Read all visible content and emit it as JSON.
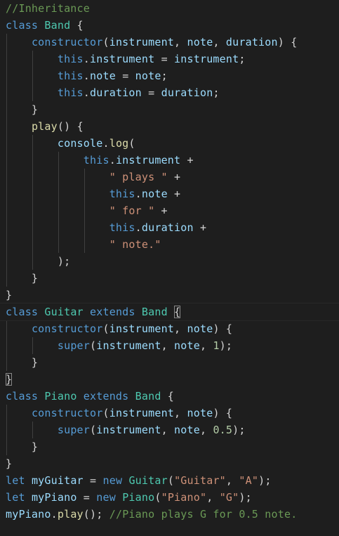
{
  "colors": {
    "background": "#1e1e1e",
    "comment": "#6a9955",
    "keyword": "#569cd6",
    "class_name": "#4ec9b0",
    "function": "#dcdcaa",
    "variable": "#9cdcfe",
    "string": "#ce9178",
    "number": "#b5cea8",
    "plain": "#d4d4d4"
  },
  "lines": [
    {
      "tokens": [
        {
          "t": "//Inheritance",
          "k": "comment"
        }
      ]
    },
    {
      "tokens": [
        {
          "t": "class ",
          "k": "keyword"
        },
        {
          "t": "Band",
          "k": "class_name"
        },
        {
          "t": " {",
          "k": "plain"
        }
      ]
    },
    {
      "tokens": [
        {
          "t": "    ",
          "k": "plain"
        },
        {
          "t": "constructor",
          "k": "keyword"
        },
        {
          "t": "(",
          "k": "plain"
        },
        {
          "t": "instrument",
          "k": "variable"
        },
        {
          "t": ", ",
          "k": "plain"
        },
        {
          "t": "note",
          "k": "variable"
        },
        {
          "t": ", ",
          "k": "plain"
        },
        {
          "t": "duration",
          "k": "variable"
        },
        {
          "t": ") {",
          "k": "plain"
        }
      ]
    },
    {
      "tokens": [
        {
          "t": "        ",
          "k": "plain"
        },
        {
          "t": "this",
          "k": "keyword"
        },
        {
          "t": ".",
          "k": "plain"
        },
        {
          "t": "instrument",
          "k": "variable"
        },
        {
          "t": " = ",
          "k": "plain"
        },
        {
          "t": "instrument",
          "k": "variable"
        },
        {
          "t": ";",
          "k": "plain"
        }
      ]
    },
    {
      "tokens": [
        {
          "t": "        ",
          "k": "plain"
        },
        {
          "t": "this",
          "k": "keyword"
        },
        {
          "t": ".",
          "k": "plain"
        },
        {
          "t": "note",
          "k": "variable"
        },
        {
          "t": " = ",
          "k": "plain"
        },
        {
          "t": "note",
          "k": "variable"
        },
        {
          "t": ";",
          "k": "plain"
        }
      ]
    },
    {
      "tokens": [
        {
          "t": "        ",
          "k": "plain"
        },
        {
          "t": "this",
          "k": "keyword"
        },
        {
          "t": ".",
          "k": "plain"
        },
        {
          "t": "duration",
          "k": "variable"
        },
        {
          "t": " = ",
          "k": "plain"
        },
        {
          "t": "duration",
          "k": "variable"
        },
        {
          "t": ";",
          "k": "plain"
        }
      ]
    },
    {
      "tokens": [
        {
          "t": "    }",
          "k": "plain"
        }
      ]
    },
    {
      "tokens": [
        {
          "t": "    ",
          "k": "plain"
        },
        {
          "t": "play",
          "k": "function"
        },
        {
          "t": "() {",
          "k": "plain"
        }
      ]
    },
    {
      "tokens": [
        {
          "t": "        ",
          "k": "plain"
        },
        {
          "t": "console",
          "k": "variable"
        },
        {
          "t": ".",
          "k": "plain"
        },
        {
          "t": "log",
          "k": "function"
        },
        {
          "t": "(",
          "k": "plain"
        }
      ]
    },
    {
      "tokens": [
        {
          "t": "            ",
          "k": "plain"
        },
        {
          "t": "this",
          "k": "keyword"
        },
        {
          "t": ".",
          "k": "plain"
        },
        {
          "t": "instrument",
          "k": "variable"
        },
        {
          "t": " +",
          "k": "plain"
        }
      ]
    },
    {
      "tokens": [
        {
          "t": "                ",
          "k": "plain"
        },
        {
          "t": "\" plays \"",
          "k": "string"
        },
        {
          "t": " +",
          "k": "plain"
        }
      ]
    },
    {
      "tokens": [
        {
          "t": "                ",
          "k": "plain"
        },
        {
          "t": "this",
          "k": "keyword"
        },
        {
          "t": ".",
          "k": "plain"
        },
        {
          "t": "note",
          "k": "variable"
        },
        {
          "t": " +",
          "k": "plain"
        }
      ]
    },
    {
      "tokens": [
        {
          "t": "                ",
          "k": "plain"
        },
        {
          "t": "\" for \"",
          "k": "string"
        },
        {
          "t": " +",
          "k": "plain"
        }
      ]
    },
    {
      "tokens": [
        {
          "t": "                ",
          "k": "plain"
        },
        {
          "t": "this",
          "k": "keyword"
        },
        {
          "t": ".",
          "k": "plain"
        },
        {
          "t": "duration",
          "k": "variable"
        },
        {
          "t": " +",
          "k": "plain"
        }
      ]
    },
    {
      "tokens": [
        {
          "t": "                ",
          "k": "plain"
        },
        {
          "t": "\" note.\"",
          "k": "string"
        }
      ]
    },
    {
      "tokens": [
        {
          "t": "        );",
          "k": "plain"
        }
      ]
    },
    {
      "tokens": [
        {
          "t": "    }",
          "k": "plain"
        }
      ]
    },
    {
      "tokens": [
        {
          "t": "}",
          "k": "plain"
        }
      ]
    },
    {
      "active": true,
      "tokens": [
        {
          "t": "class ",
          "k": "keyword"
        },
        {
          "t": "Guitar",
          "k": "class_name"
        },
        {
          "t": " ",
          "k": "plain"
        },
        {
          "t": "extends",
          "k": "keyword"
        },
        {
          "t": " ",
          "k": "plain"
        },
        {
          "t": "Band",
          "k": "class_name"
        },
        {
          "t": " ",
          "k": "plain"
        },
        {
          "t": "{",
          "k": "plain",
          "boxed": true
        }
      ]
    },
    {
      "tokens": [
        {
          "t": "    ",
          "k": "plain"
        },
        {
          "t": "constructor",
          "k": "keyword"
        },
        {
          "t": "(",
          "k": "plain"
        },
        {
          "t": "instrument",
          "k": "variable"
        },
        {
          "t": ", ",
          "k": "plain"
        },
        {
          "t": "note",
          "k": "variable"
        },
        {
          "t": ") {",
          "k": "plain"
        }
      ]
    },
    {
      "tokens": [
        {
          "t": "        ",
          "k": "plain"
        },
        {
          "t": "super",
          "k": "keyword"
        },
        {
          "t": "(",
          "k": "plain"
        },
        {
          "t": "instrument",
          "k": "variable"
        },
        {
          "t": ", ",
          "k": "plain"
        },
        {
          "t": "note",
          "k": "variable"
        },
        {
          "t": ", ",
          "k": "plain"
        },
        {
          "t": "1",
          "k": "number"
        },
        {
          "t": ");",
          "k": "plain"
        }
      ]
    },
    {
      "tokens": [
        {
          "t": "    }",
          "k": "plain"
        }
      ]
    },
    {
      "tokens": [
        {
          "t": "}",
          "k": "plain",
          "boxed": true
        }
      ]
    },
    {
      "tokens": [
        {
          "t": "class ",
          "k": "keyword"
        },
        {
          "t": "Piano",
          "k": "class_name"
        },
        {
          "t": " ",
          "k": "plain"
        },
        {
          "t": "extends",
          "k": "keyword"
        },
        {
          "t": " ",
          "k": "plain"
        },
        {
          "t": "Band",
          "k": "class_name"
        },
        {
          "t": " {",
          "k": "plain"
        }
      ]
    },
    {
      "tokens": [
        {
          "t": "    ",
          "k": "plain"
        },
        {
          "t": "constructor",
          "k": "keyword"
        },
        {
          "t": "(",
          "k": "plain"
        },
        {
          "t": "instrument",
          "k": "variable"
        },
        {
          "t": ", ",
          "k": "plain"
        },
        {
          "t": "note",
          "k": "variable"
        },
        {
          "t": ") {",
          "k": "plain"
        }
      ]
    },
    {
      "tokens": [
        {
          "t": "        ",
          "k": "plain"
        },
        {
          "t": "super",
          "k": "keyword"
        },
        {
          "t": "(",
          "k": "plain"
        },
        {
          "t": "instrument",
          "k": "variable"
        },
        {
          "t": ", ",
          "k": "plain"
        },
        {
          "t": "note",
          "k": "variable"
        },
        {
          "t": ", ",
          "k": "plain"
        },
        {
          "t": "0.5",
          "k": "number"
        },
        {
          "t": ");",
          "k": "plain"
        }
      ]
    },
    {
      "tokens": [
        {
          "t": "    }",
          "k": "plain"
        }
      ]
    },
    {
      "tokens": [
        {
          "t": "}",
          "k": "plain"
        }
      ]
    },
    {
      "tokens": [
        {
          "t": "let ",
          "k": "keyword"
        },
        {
          "t": "myGuitar",
          "k": "variable"
        },
        {
          "t": " = ",
          "k": "plain"
        },
        {
          "t": "new ",
          "k": "keyword"
        },
        {
          "t": "Guitar",
          "k": "class_name"
        },
        {
          "t": "(",
          "k": "plain"
        },
        {
          "t": "\"Guitar\"",
          "k": "string"
        },
        {
          "t": ", ",
          "k": "plain"
        },
        {
          "t": "\"A\"",
          "k": "string"
        },
        {
          "t": ");",
          "k": "plain"
        }
      ]
    },
    {
      "tokens": [
        {
          "t": "let ",
          "k": "keyword"
        },
        {
          "t": "myPiano",
          "k": "variable"
        },
        {
          "t": " = ",
          "k": "plain"
        },
        {
          "t": "new ",
          "k": "keyword"
        },
        {
          "t": "Piano",
          "k": "class_name"
        },
        {
          "t": "(",
          "k": "plain"
        },
        {
          "t": "\"Piano\"",
          "k": "string"
        },
        {
          "t": ", ",
          "k": "plain"
        },
        {
          "t": "\"G\"",
          "k": "string"
        },
        {
          "t": ");",
          "k": "plain"
        }
      ]
    },
    {
      "tokens": [
        {
          "t": "myPiano",
          "k": "variable"
        },
        {
          "t": ".",
          "k": "plain"
        },
        {
          "t": "play",
          "k": "function"
        },
        {
          "t": "(); ",
          "k": "plain"
        },
        {
          "t": "//Piano plays G for 0.5 note.",
          "k": "comment"
        }
      ]
    }
  ]
}
